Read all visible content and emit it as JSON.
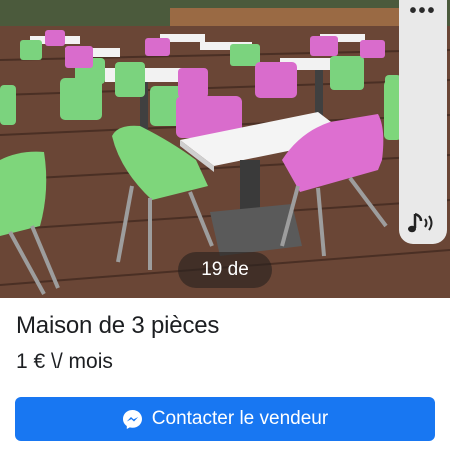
{
  "listing": {
    "photo_counter": "19 de",
    "title": "Maison de 3 pièces",
    "price": "1 € \\/ mois"
  },
  "cta": {
    "label": "Contacter le vendeur",
    "icon": "messenger-icon",
    "color": "#1877f2"
  },
  "side_panel": {
    "top_icon": "more-options-icon",
    "bottom_icon": "music-sound-icon"
  }
}
